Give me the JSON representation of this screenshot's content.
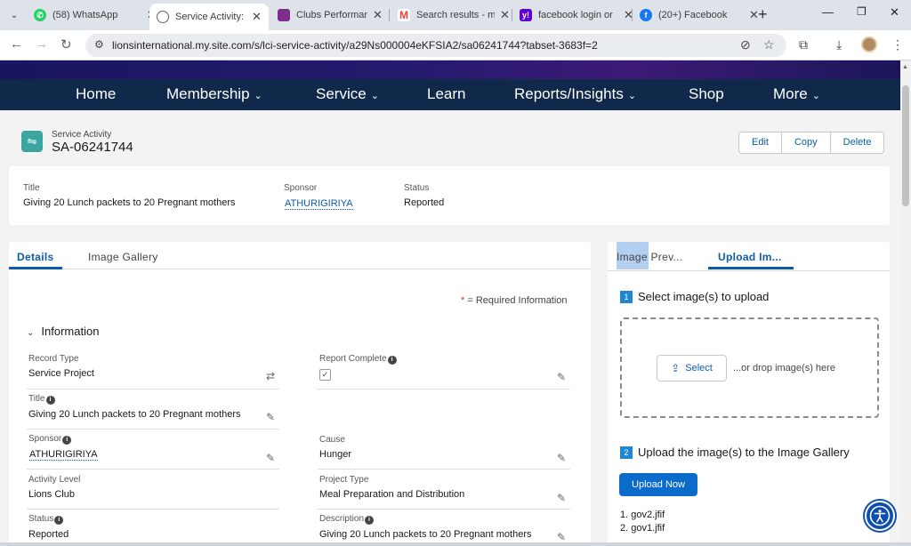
{
  "browser": {
    "tabs": [
      {
        "title": "(58) WhatsApp",
        "icon": "whatsapp-icon",
        "color": "#25d366"
      },
      {
        "title": "Service Activity: SA",
        "icon": "globe-icon",
        "color": "#5f6368",
        "active": true
      },
      {
        "title": "Clubs Performance",
        "icon": "lions-logo-icon",
        "color": "#7b2f8a"
      },
      {
        "title": "Search results - m",
        "icon": "gmail-icon",
        "color": "#ea4335"
      },
      {
        "title": "facebook login or",
        "icon": "yahoo-icon",
        "color": "#6001d2"
      },
      {
        "title": "(20+) Facebook",
        "icon": "facebook-icon",
        "color": "#1877f2"
      }
    ],
    "url": "lionsinternational.my.site.com/s/lci-service-activity/a29Ns000004eKFSIA2/sa06241744?tabset-3683f=2"
  },
  "site_nav": {
    "items": [
      {
        "label": "Home",
        "dropdown": false
      },
      {
        "label": "Membership",
        "dropdown": true
      },
      {
        "label": "Service",
        "dropdown": true
      },
      {
        "label": "Learn",
        "dropdown": false
      },
      {
        "label": "Reports/Insights",
        "dropdown": true
      },
      {
        "label": "Shop",
        "dropdown": false
      },
      {
        "label": "More",
        "dropdown": true
      }
    ]
  },
  "record": {
    "type": "Service Activity",
    "name": "SA-06241744",
    "actions": [
      "Edit",
      "Copy",
      "Delete"
    ]
  },
  "highlights": {
    "title_label": "Title",
    "title_value": "Giving 20 Lunch packets to 20 Pregnant mothers",
    "sponsor_label": "Sponsor",
    "sponsor_value": "ATHURIGIRIYA",
    "status_label": "Status",
    "status_value": "Reported"
  },
  "details": {
    "tabs": [
      "Details",
      "Image Gallery"
    ],
    "required_info": "= Required Information",
    "section_title": "Information",
    "fields": {
      "record_type_label": "Record Type",
      "record_type_value": "Service Project",
      "report_complete_label": "Report Complete",
      "report_complete_value": "✓",
      "title_label": "Title",
      "title_value": "Giving 20 Lunch packets to 20 Pregnant mothers",
      "sponsor_label": "Sponsor",
      "sponsor_value": "ATHURIGIRIYA",
      "cause_label": "Cause",
      "cause_value": "Hunger",
      "activity_level_label": "Activity Level",
      "activity_level_value": "Lions Club",
      "project_type_label": "Project Type",
      "project_type_value": "Meal Preparation and Distribution",
      "status_label": "Status",
      "status_value": "Reported",
      "description_label": "Description",
      "description_value": "Giving 20 Lunch packets to 20 Pregnant mothers"
    }
  },
  "upload": {
    "tab_preview": "Image Prev...",
    "tab_preview_highlight": "Image",
    "tab_preview_rest": " Prev...",
    "tab_upload": "Upload Im...",
    "step1_num": "1",
    "step1": "Select image(s) to upload",
    "select_label": "Select",
    "drop_text": "...or drop image(s) here",
    "step2_num": "2",
    "step2": "Upload the image(s) to the Image Gallery",
    "upload_now_label": "Upload Now",
    "files": [
      "1. gov2.jfif",
      "2. gov1.jfif"
    ]
  }
}
